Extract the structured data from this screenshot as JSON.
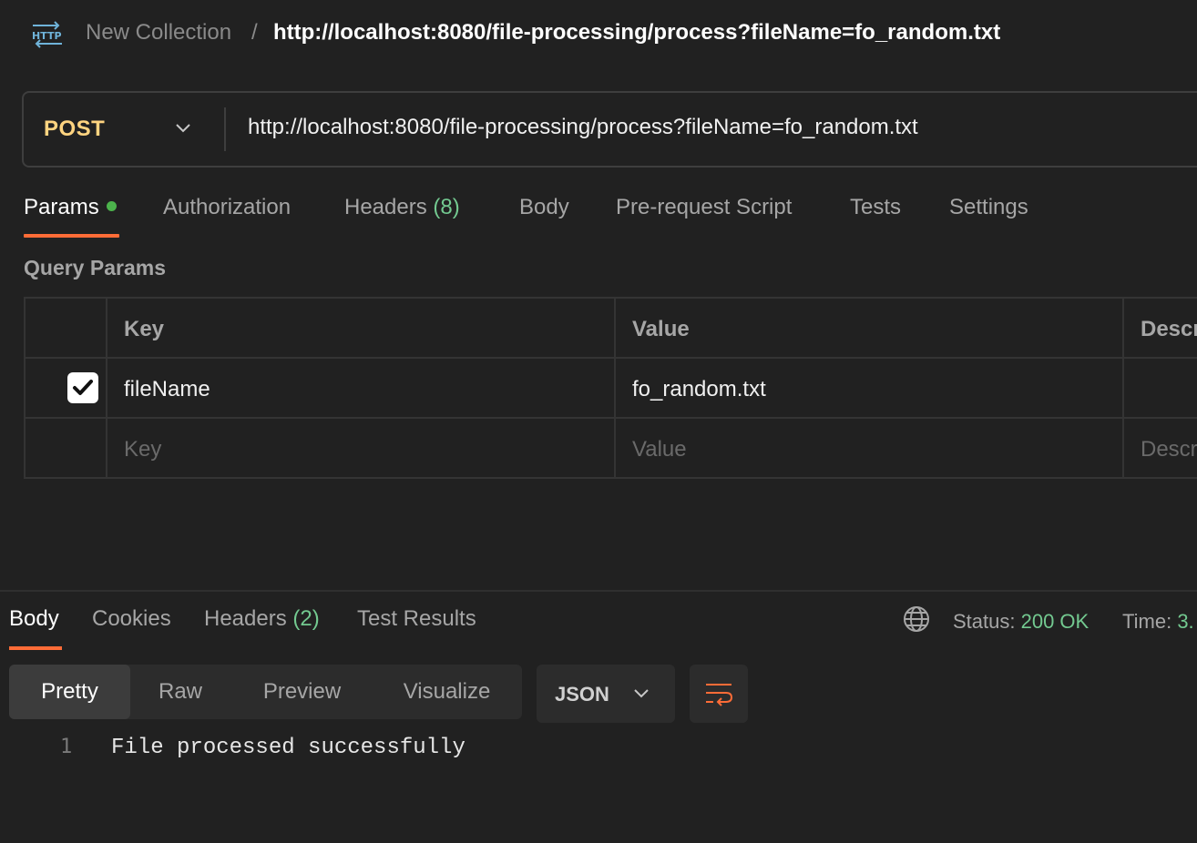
{
  "breadcrumb": {
    "collection": "New Collection",
    "separator": "/",
    "request": "http://localhost:8080/file-processing/process?fileName=fo_random.txt"
  },
  "icons": {
    "request_type": "http-icon",
    "method_dropdown": "chevron-down-icon",
    "globe": "globe-icon",
    "format_dropdown": "chevron-down-icon",
    "wrap": "text-wrap-icon",
    "checkbox": "checkmark-icon"
  },
  "request": {
    "method": "POST",
    "url": "http://localhost:8080/file-processing/process?fileName=fo_random.txt"
  },
  "request_tabs": [
    {
      "label": "Params",
      "active": true,
      "indicator": true
    },
    {
      "label": "Authorization"
    },
    {
      "label": "Headers",
      "count": "(8)"
    },
    {
      "label": "Body"
    },
    {
      "label": "Pre-request Script"
    },
    {
      "label": "Tests"
    },
    {
      "label": "Settings"
    }
  ],
  "query_params": {
    "title": "Query Params",
    "headers": {
      "key": "Key",
      "value": "Value",
      "description": "Descr"
    },
    "rows": [
      {
        "checked": true,
        "key": "fileName",
        "value": "fo_random.txt",
        "description": ""
      }
    ],
    "placeholder": {
      "key": "Key",
      "value": "Value",
      "description": "Descr"
    }
  },
  "response": {
    "tabs": [
      {
        "label": "Body",
        "active": true
      },
      {
        "label": "Cookies"
      },
      {
        "label": "Headers",
        "count": "(2)"
      },
      {
        "label": "Test Results"
      }
    ],
    "status_label": "Status:",
    "status_value": "200 OK",
    "time_label": "Time:",
    "time_value": "3."
  },
  "view": {
    "modes": [
      "Pretty",
      "Raw",
      "Preview",
      "Visualize"
    ],
    "active_mode": "Pretty",
    "format": "JSON"
  },
  "body_lines": [
    {
      "number": "1",
      "text": "File processed successfully"
    }
  ],
  "colors": {
    "background": "#212121",
    "accent": "#ff6c37",
    "method": "#ffd480",
    "success": "#73c990",
    "indicator_dot": "#4cb34c"
  }
}
